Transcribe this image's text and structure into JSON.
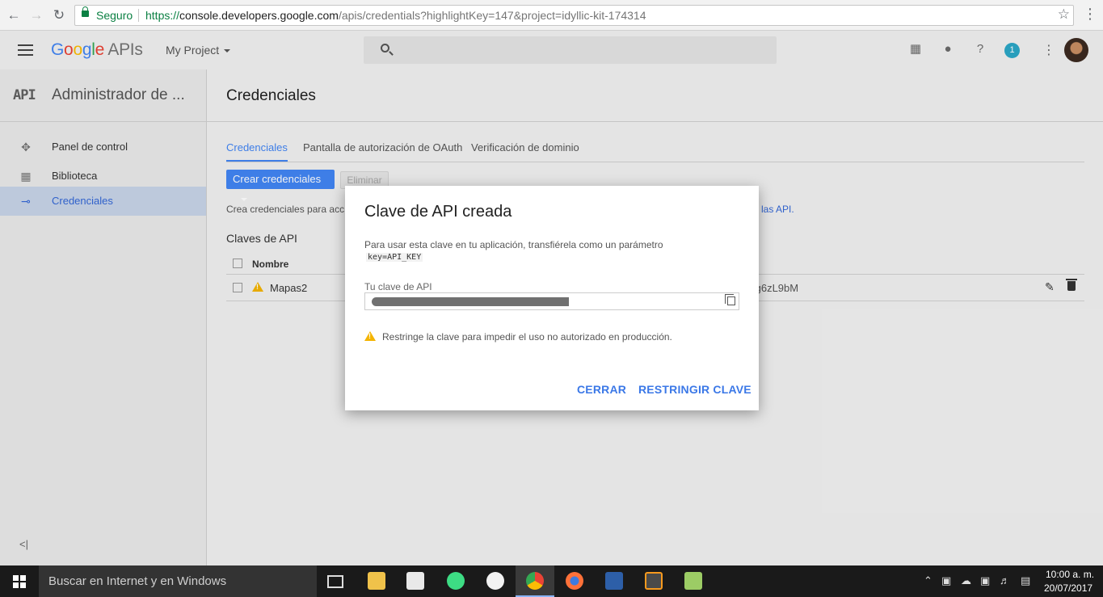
{
  "browser": {
    "secure_label": "Seguro",
    "url_scheme": "https://",
    "url_host": "console.developers.google.com",
    "url_path": "/apis/credentials?highlightKey=147&project=idyllic-kit-174314"
  },
  "appbar": {
    "logo_letters": [
      "G",
      "o",
      "o",
      "g",
      "l",
      "e"
    ],
    "logo_suffix": "APIs",
    "project": "My Project",
    "notification_count": "1"
  },
  "sidebar": {
    "badge": "API",
    "title": "Administrador de ...",
    "items": [
      {
        "label": "Panel de control",
        "icon": "dashboard-icon"
      },
      {
        "label": "Biblioteca",
        "icon": "library-icon"
      },
      {
        "label": "Credenciales",
        "icon": "key-icon",
        "active": true
      }
    ]
  },
  "main": {
    "title": "Credenciales",
    "tabs": [
      "Credenciales",
      "Pantalla de autorización de OAuth",
      "Verificación de dominio"
    ],
    "create_button": "Crear credenciales",
    "delete_button": "Eliminar",
    "hint_text": "Crea credenciales para acc",
    "hint_link": "re las API.",
    "section_title": "Claves de API",
    "table": {
      "columns": [
        "Nombre"
      ],
      "rows": [
        {
          "name": "Mapas2",
          "key_suffix": "/g6zL9bM"
        }
      ]
    }
  },
  "dialog": {
    "title": "Clave de API creada",
    "description": "Para usar esta clave en tu aplicación, transfiérela como un parámetro",
    "param": "key=API_KEY",
    "field_label": "Tu clave de API",
    "warning": "Restringe la clave para impedir el uso no autorizado en producción.",
    "close_button": "CERRAR",
    "restrict_button": "RESTRINGIR CLAVE"
  },
  "taskbar": {
    "search_placeholder": "Buscar en Internet y en Windows",
    "time": "10:00 a. m.",
    "date": "20/07/2017"
  },
  "colors": {
    "accent": "#4285f4",
    "link": "#3367d6",
    "warning": "#f4b400",
    "secure": "#0b8043"
  }
}
